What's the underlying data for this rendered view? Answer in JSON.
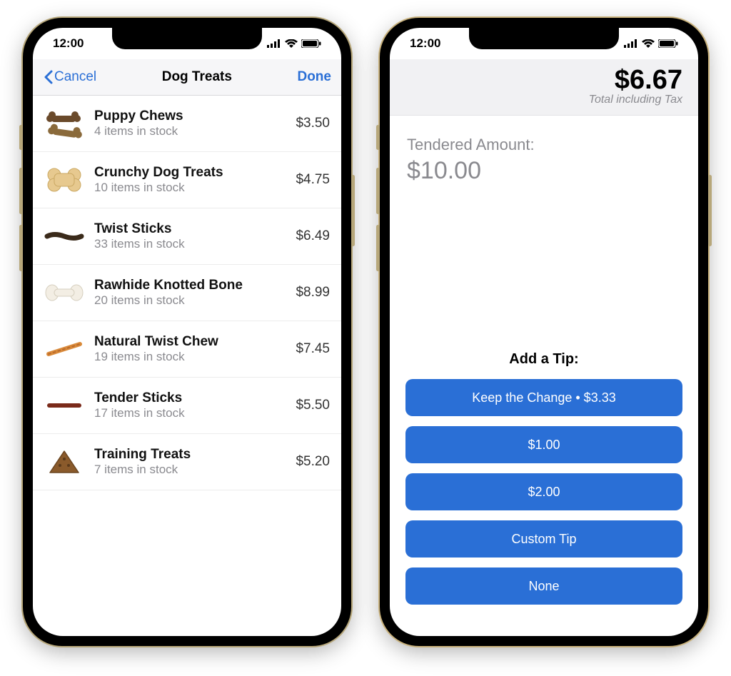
{
  "status": {
    "time": "12:00"
  },
  "left": {
    "nav": {
      "cancel": "Cancel",
      "title": "Dog Treats",
      "done": "Done"
    },
    "items": [
      {
        "name": "Puppy Chews",
        "sub": "4 items in stock",
        "price": "$3.50",
        "icon": "bone-pile"
      },
      {
        "name": "Crunchy Dog Treats",
        "sub": "10 items in stock",
        "price": "$4.75",
        "icon": "biscuit"
      },
      {
        "name": "Twist Sticks",
        "sub": "33 items in stock",
        "price": "$6.49",
        "icon": "dark-stick"
      },
      {
        "name": "Rawhide Knotted Bone",
        "sub": "20 items in stock",
        "price": "$8.99",
        "icon": "knot-bone"
      },
      {
        "name": "Natural Twist Chew",
        "sub": "19 items in stock",
        "price": "$7.45",
        "icon": "orange-stick"
      },
      {
        "name": "Tender Sticks",
        "sub": "17 items in stock",
        "price": "$5.50",
        "icon": "red-stick"
      },
      {
        "name": "Training Treats",
        "sub": "7 items in stock",
        "price": "$5.20",
        "icon": "triangle"
      }
    ]
  },
  "right": {
    "total": {
      "amount": "$6.67",
      "sub": "Total including Tax"
    },
    "tendered": {
      "label": "Tendered Amount:",
      "amount": "$10.00"
    },
    "tip_title": "Add a Tip:",
    "tip_buttons": [
      "Keep the Change • $3.33",
      "$1.00",
      "$2.00",
      "Custom Tip",
      "None"
    ]
  }
}
